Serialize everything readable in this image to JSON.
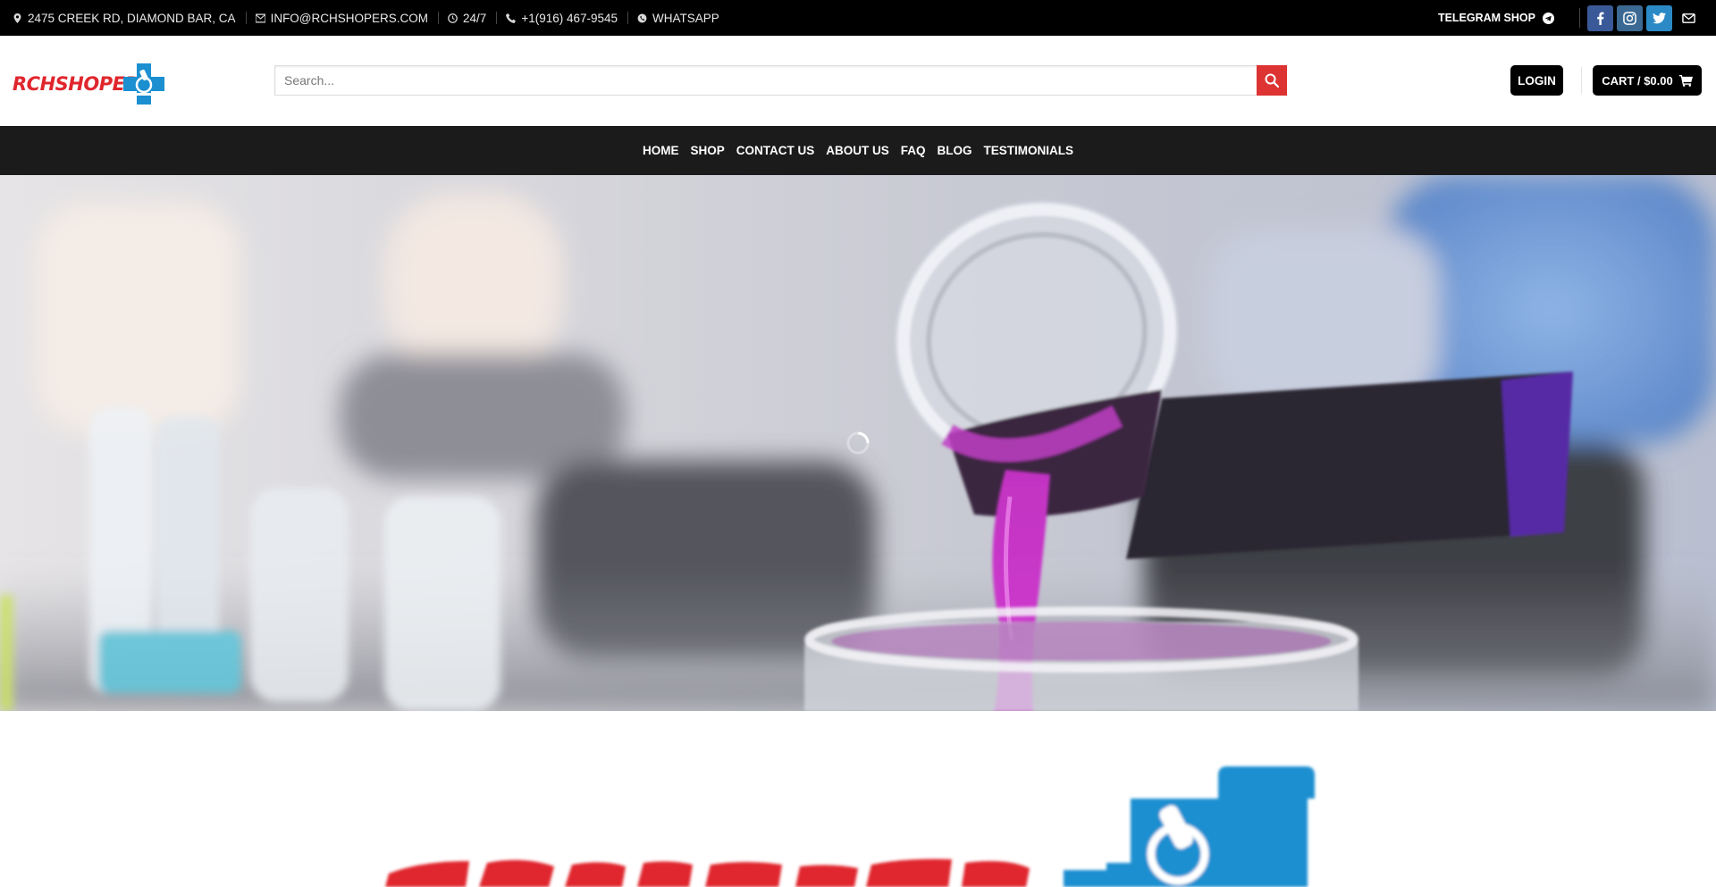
{
  "topbar": {
    "address": "2475 CREEK RD, DIAMOND BAR, CA",
    "email": "INFO@RCHSHOPERS.COM",
    "hours": "24/7",
    "phone": "+1(916) 467-9545",
    "whatsapp": "WHATSAPP",
    "telegram": "TELEGRAM SHOP"
  },
  "header": {
    "logo_text": "RCHSHOPERS",
    "search_placeholder": "Search...",
    "login_label": "LOGIN",
    "cart_label": "CART / $0.00"
  },
  "nav": {
    "items": [
      "HOME",
      "SHOP",
      "CONTACT US",
      "ABOUT US",
      "FAQ",
      "BLOG",
      "TESTIMONIALS"
    ]
  },
  "colors": {
    "brand_red": "#dd3333",
    "topbar_bg": "#000000",
    "nav_bg": "#1b1b1b",
    "logo_blue": "#1b8fd0"
  },
  "icons": {
    "address": "map-pin-icon",
    "email": "envelope-icon",
    "hours": "clock-icon",
    "phone": "phone-icon",
    "whatsapp": "whatsapp-icon",
    "telegram": "telegram-icon",
    "social": [
      "facebook-icon",
      "instagram-icon",
      "twitter-icon",
      "mail-icon"
    ],
    "search": "search-icon",
    "cart": "cart-icon"
  }
}
